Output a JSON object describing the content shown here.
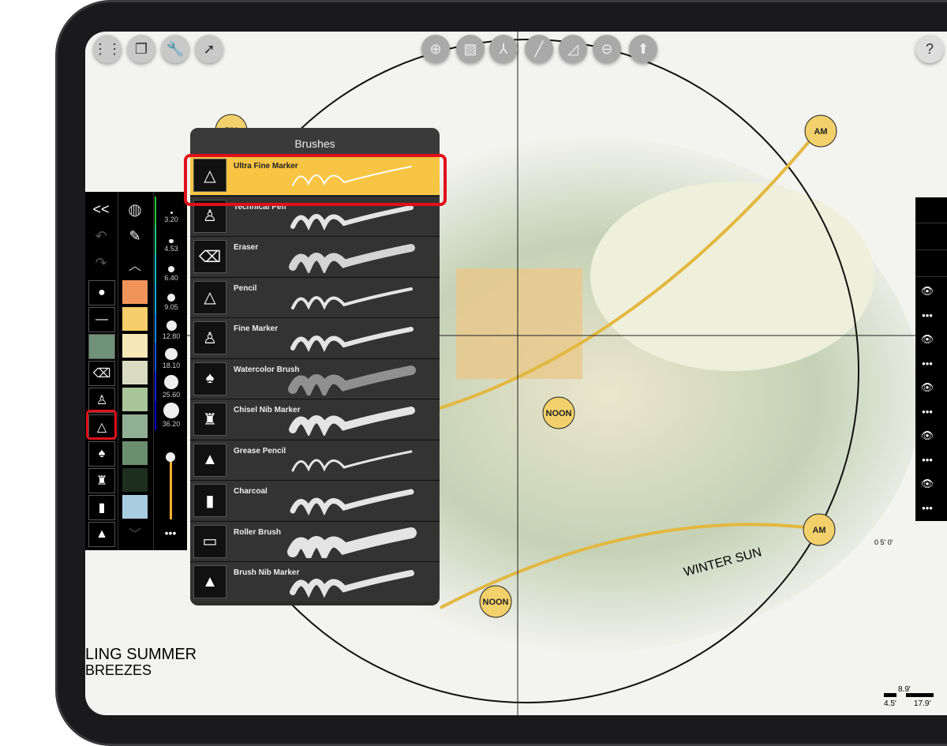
{
  "top_left_tools": [
    {
      "icon": "grid-menu-icon"
    },
    {
      "icon": "layers-stack-icon"
    },
    {
      "icon": "wrench-icon"
    },
    {
      "icon": "lasso-select-icon"
    }
  ],
  "top_center_tools": [
    {
      "icon": "perspective-icon"
    },
    {
      "icon": "hatch-icon"
    },
    {
      "icon": "axis-icon"
    },
    {
      "icon": "ruler-icon"
    },
    {
      "icon": "triangle-icon"
    },
    {
      "icon": "circle-minus-icon"
    },
    {
      "icon": "stamp-icon"
    }
  ],
  "help_label": "?",
  "left_toolbar": {
    "collapse_label": "<<",
    "tools": [
      "dot-brush",
      "line-brush",
      "color-fill",
      "eraser",
      "technical-pen",
      "ultra-fine-marker",
      "watercolor-brush",
      "chisel-marker",
      "charcoal",
      "brush-nib-marker"
    ],
    "swatches": [
      "#f0945a",
      "#f5cd6a",
      "#f7e8b8",
      "#d9dcc0",
      "#a9c69a",
      "#90b095",
      "#6b8f6e",
      "#1e2e1e",
      "#a8cde0"
    ],
    "current_color": "#6f9278",
    "sizes": [
      "3.20",
      "4.53",
      "6.40",
      "9.05",
      "12.80",
      "18.10",
      "25.60",
      "36.20"
    ],
    "opacity": 1.0,
    "more_label": "•••"
  },
  "brushes": {
    "title": "Brushes",
    "items": [
      {
        "label": "Ultra Fine Marker",
        "selected": true
      },
      {
        "label": "Technical Pen"
      },
      {
        "label": "Eraser"
      },
      {
        "label": "Pencil"
      },
      {
        "label": "Fine Marker"
      },
      {
        "label": "Watercolor Brush"
      },
      {
        "label": "Chisel Nib Marker"
      },
      {
        "label": "Grease Pencil"
      },
      {
        "label": "Charcoal"
      },
      {
        "label": "Roller Brush"
      },
      {
        "label": "Brush Nib Marker"
      }
    ]
  },
  "canvas_labels": {
    "am1": "AM",
    "am2": "AM",
    "pm": "PM",
    "noon1": "NOON",
    "noon2": "NOON",
    "winter": "WINTER SUN",
    "summer": "LING SUMMER",
    "breezes": "BREEZES",
    "scale_top": "8.9'",
    "scale_a": "4.5'",
    "scale_b": "17.9'",
    "scale_small": "0 5' 0'"
  },
  "accent": "#f7c444",
  "highlight": "#e0101a"
}
